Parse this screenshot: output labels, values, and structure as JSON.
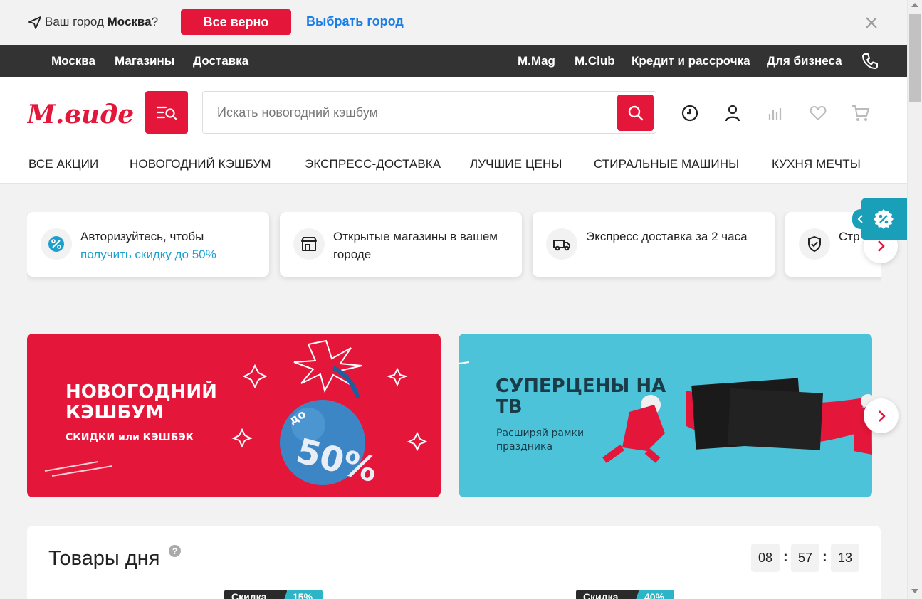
{
  "city_prompt": {
    "question_prefix": "Ваш город",
    "city": "Москва",
    "question_suffix": "?",
    "confirm_label": "Все верно",
    "choose_label": "Выбрать город"
  },
  "top_nav": {
    "left": [
      "Москва",
      "Магазины",
      "Доставка"
    ],
    "right": [
      "M.Mag",
      "M.Club",
      "Кредит и рассрочка",
      "Для бизнеса"
    ]
  },
  "header": {
    "logo_text": "М.видео",
    "search_placeholder": "Искать новогодний кэшбум"
  },
  "category_menu": [
    "ВСЕ АКЦИИ",
    "НОВОГОДНИЙ КЭШБУМ",
    "ЭКСПРЕСС-ДОСТАВКА",
    "ЛУЧШИЕ ЦЕНЫ",
    "СТИРАЛЬНЫЕ МАШИНЫ",
    "КУХНЯ МЕЧТЫ"
  ],
  "info_cards": [
    {
      "icon": "percent-icon",
      "line1": "Авторизуйтесь, чтобы",
      "accent": "получить скидку до 50%"
    },
    {
      "icon": "store-icon",
      "text": "Открытые магазины в вашем городе"
    },
    {
      "icon": "truck-icon",
      "text": "Экспресс доставка за 2 часа"
    },
    {
      "icon": "shield-icon",
      "text": "Стр утра"
    }
  ],
  "banners": [
    {
      "title": "НОВОГОДНИЙ КЭШБУМ",
      "subtitle": "СКИДКИ или КЭШБЭК",
      "bomb_text_top": "до",
      "bomb_text_big": "50%"
    },
    {
      "title": "СУПЕРЦЕНЫ НА ТВ",
      "subtitle": "Расширяй рамки праздника"
    }
  ],
  "products_of_day": {
    "title": "Товары дня",
    "help": "?",
    "timer": {
      "hours": "08",
      "minutes": "57",
      "seconds": "13",
      "sep": ":"
    },
    "badges": [
      {
        "label": "Скидка",
        "value": "15%"
      },
      {
        "label": "Скидка",
        "value": "40%"
      }
    ]
  },
  "colors": {
    "brand_red": "#e4163a",
    "link_blue": "#1a7ee6",
    "accent_teal": "#1a9fcf",
    "dark_nav": "#333333"
  }
}
